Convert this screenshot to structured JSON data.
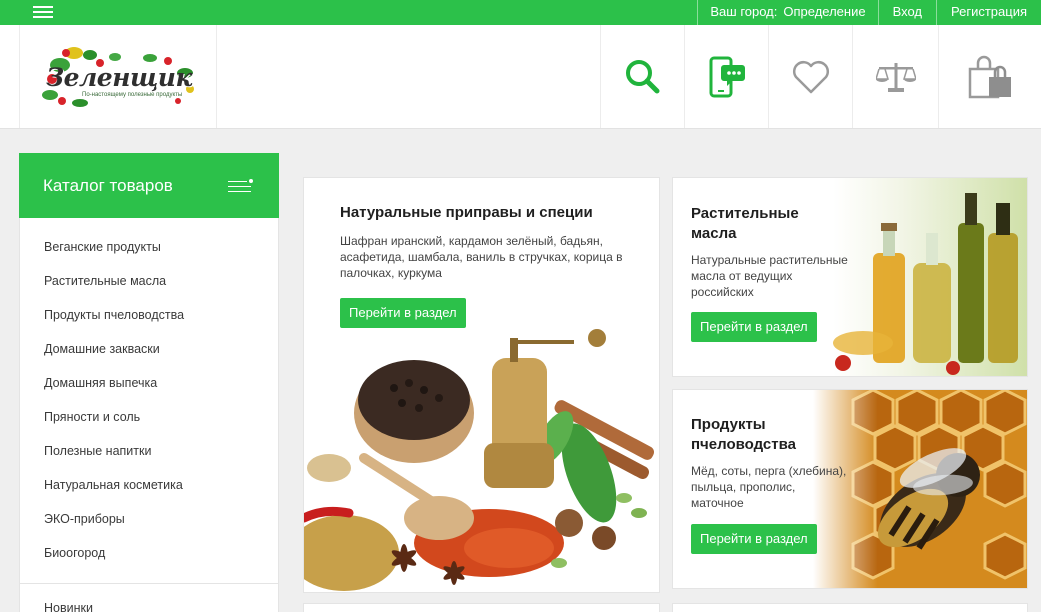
{
  "topbar": {
    "city_label": "Ваш город:",
    "city_value": "Определение",
    "login": "Вход",
    "register": "Регистрация"
  },
  "header": {
    "logo_text": "Зеленщик",
    "logo_tagline": "По-настоящему полезные продукты",
    "icons": [
      "search-icon",
      "phone-chat-icon",
      "heart-icon",
      "scales-icon",
      "shopping-bag-icon"
    ]
  },
  "catalog": {
    "title": "Каталог товаров",
    "items": [
      "Веганские продукты",
      "Растительные масла",
      "Продукты пчеловодства",
      "Домашние закваски",
      "Домашняя выпечка",
      "Пряности и соль",
      "Полезные напитки",
      "Натуральная косметика",
      "ЭКО-приборы",
      "Биоогород"
    ],
    "extra_item": "Новинки"
  },
  "cards": {
    "spices": {
      "title": "Натуральные приправы и специи",
      "desc": "Шафран иранский, кардамон зелёный, бадьян, асафетида, шамбала, ваниль в стручках, корица в палочках, куркума",
      "button": "Перейти в раздел"
    },
    "oils": {
      "title": "Растительные масла",
      "desc": "Натуральные растительные масла от ведущих российских",
      "button": "Перейти в раздел"
    },
    "bee": {
      "title": "Продукты пчеловодства",
      "desc": "Мёд, соты, перга (хлебина), пыльца, прополис, маточное",
      "button": "Перейти в раздел"
    }
  },
  "colors": {
    "accent": "#2cc14a",
    "icon_green": "#20b43c",
    "icon_gray": "#9a9a9a"
  }
}
